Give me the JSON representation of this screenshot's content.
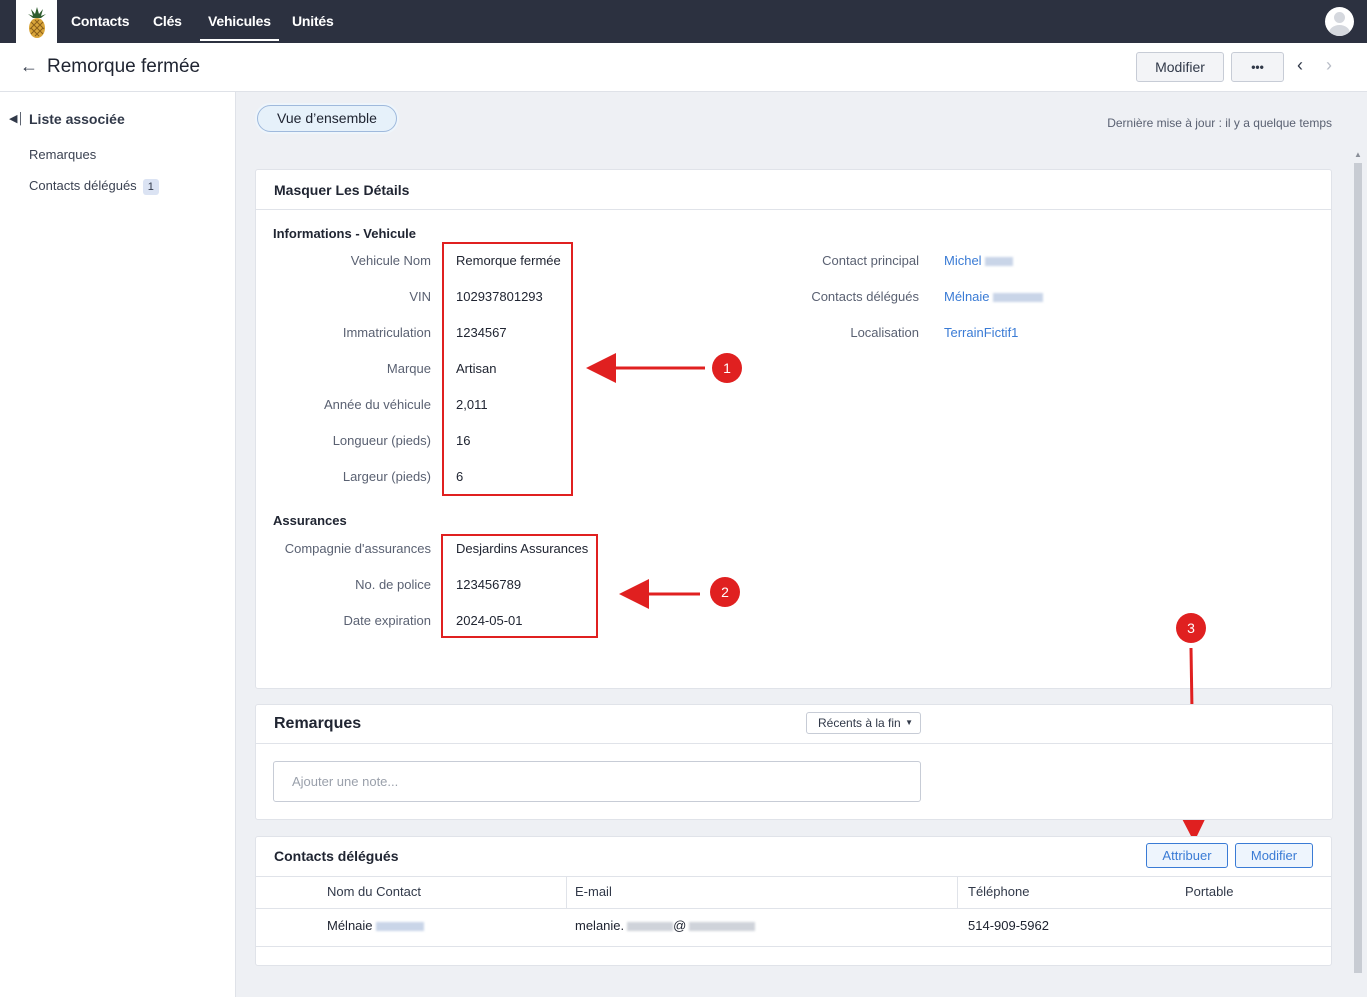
{
  "nav": {
    "tabs": [
      "Contacts",
      "Clés",
      "Vehicules",
      "Unités"
    ],
    "active_tab": "Vehicules"
  },
  "header": {
    "title": "Remorque fermée",
    "edit_button": "Modifier",
    "more_button": "•••"
  },
  "sidebar": {
    "heading": "Liste associée",
    "items": [
      {
        "label": "Remarques"
      },
      {
        "label": "Contacts délégués",
        "count": "1"
      }
    ]
  },
  "main": {
    "overview_tab": "Vue d’ensemble",
    "last_update": "Dernière mise à jour : il y a quelque temps"
  },
  "details": {
    "toggle_label": "Masquer Les Détails",
    "vehicle_section": "Informations - Vehicule",
    "vehicle_fields": [
      {
        "label": "Vehicule Nom",
        "value": "Remorque fermée"
      },
      {
        "label": "VIN",
        "value": "102937801293"
      },
      {
        "label": "Immatriculation",
        "value": "1234567"
      },
      {
        "label": "Marque",
        "value": "Artisan"
      },
      {
        "label": "Année du véhicule",
        "value": "2,011"
      },
      {
        "label": "Longueur (pieds)",
        "value": "16"
      },
      {
        "label": "Largeur (pieds)",
        "value": "6"
      }
    ],
    "right_fields": [
      {
        "label": "Contact principal",
        "value": "Michel"
      },
      {
        "label": "Contacts délégués",
        "value": "Mélnaie"
      },
      {
        "label": "Localisation",
        "value": "TerrainFictif1"
      }
    ],
    "insurance_section": "Assurances",
    "insurance_fields": [
      {
        "label": "Compagnie d'assurances",
        "value": "Desjardins Assurances"
      },
      {
        "label": "No. de police",
        "value": "123456789"
      },
      {
        "label": "Date expiration",
        "value": "2024-05-01"
      }
    ]
  },
  "annotations": [
    "1",
    "2",
    "3"
  ],
  "remarks": {
    "title": "Remarques",
    "sort_label": "Récents à la fin",
    "note_placeholder": "Ajouter une note..."
  },
  "delegates": {
    "title": "Contacts délégués",
    "assign_button": "Attribuer",
    "edit_button": "Modifier",
    "columns": [
      "Nom du Contact",
      "E-mail",
      "Téléphone",
      "Portable"
    ],
    "rows": [
      {
        "name": "Mélnaie",
        "email_start": "melanie.",
        "email_at": "@",
        "phone": "514-909-5962",
        "mobile": ""
      }
    ]
  },
  "colors": {
    "nav_bg": "#2c3140",
    "link": "#3a7bd5",
    "annotation_red": "#e02020"
  }
}
